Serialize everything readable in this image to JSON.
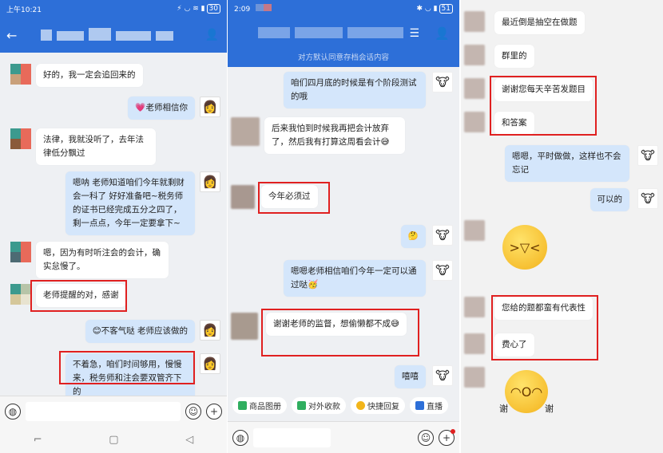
{
  "panel1": {
    "status_time": "上午10:21",
    "battery": "30",
    "messages": [
      {
        "side": "left",
        "text": "好的，我一定会追回来的"
      },
      {
        "side": "right",
        "text": "💗老师相信你"
      },
      {
        "side": "left",
        "text": "法律，我就没听了，去年法律低分飘过"
      },
      {
        "side": "right",
        "text": "嗯呐 老师知道咱们今年就剩财会一科了 好好准备吧~税务师的证书已经完成五分之四了，剩一点点，今年一定要拿下~"
      },
      {
        "side": "left",
        "text": "嗯，因为有时听注会的会计，确实怠慢了。"
      },
      {
        "side": "left",
        "text": "老师提醒的对，感谢"
      },
      {
        "side": "right",
        "text": "😊不客气哒 老师应该做的"
      },
      {
        "side": "right",
        "text": "不着急，咱们时间够用，慢慢来，税务师和注会要双管齐下的"
      }
    ],
    "nav": [
      "⌐",
      "▢",
      "◁"
    ]
  },
  "panel2": {
    "status_time": "2:09",
    "battery": "51",
    "notice": "对方默认同意存档会话内容",
    "messages": [
      {
        "side": "right",
        "text": "咱们四月底的时候是有个阶段测试的哦"
      },
      {
        "side": "left",
        "text": "后来我怕到时候我再把会计放弃了，然后我有打算这周看会计😅"
      },
      {
        "side": "left",
        "text": "今年必须过"
      },
      {
        "side": "right",
        "text": "🤔"
      },
      {
        "side": "right",
        "text": "嗯嗯老师相信咱们今年一定可以通过哒🥳"
      },
      {
        "side": "left",
        "text": "谢谢老师的监督，想偷懒都不成😅"
      },
      {
        "side": "right",
        "text": "嘻嘻"
      }
    ],
    "quick_actions": [
      "商品图册",
      "对外收款",
      "快捷回复",
      "直播"
    ]
  },
  "panel3": {
    "messages": [
      {
        "side": "left",
        "text": "最近倒是抽空在做题"
      },
      {
        "side": "left",
        "text": "群里的"
      },
      {
        "side": "left",
        "text": "谢谢您每天辛苦发题目"
      },
      {
        "side": "left",
        "text": "和答案"
      },
      {
        "side": "right",
        "text": "嗯嗯，平时做做，这样也不会忘记"
      },
      {
        "side": "right",
        "text": "可以的"
      },
      {
        "side": "left",
        "text": "您给的题都蛮有代表性"
      },
      {
        "side": "left",
        "text": "费心了"
      }
    ],
    "sticker_caption_left": "谢",
    "sticker_caption_right": "谢"
  },
  "colors": {
    "header": "#2d6fd8",
    "bubble_blue": "#d4e6fb",
    "highlight": "#e02020"
  }
}
